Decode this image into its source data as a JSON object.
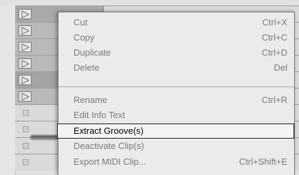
{
  "clips": [
    {
      "type": "filled",
      "shade": "top"
    },
    {
      "type": "filled",
      "shade": "light"
    },
    {
      "type": "filled",
      "shade": "light"
    },
    {
      "type": "filled",
      "shade": "light"
    },
    {
      "type": "filled",
      "shade": "dark"
    },
    {
      "type": "filled",
      "shade": "light"
    },
    {
      "type": "empty"
    },
    {
      "type": "empty"
    },
    {
      "type": "empty"
    },
    {
      "type": "empty"
    }
  ],
  "context_menu": {
    "items": [
      {
        "label": "Cut",
        "shortcut": "Ctrl+X",
        "state": "normal"
      },
      {
        "label": "Copy",
        "shortcut": "Ctrl+C",
        "state": "normal"
      },
      {
        "label": "Duplicate",
        "shortcut": "Ctrl+D",
        "state": "normal"
      },
      {
        "label": "Delete",
        "shortcut": "Del",
        "state": "normal"
      },
      {
        "label": "Rename",
        "shortcut": "Ctrl+R",
        "state": "normal"
      },
      {
        "label": "Edit Info Text",
        "shortcut": "",
        "state": "normal"
      },
      {
        "label": "Extract Groove(s)",
        "shortcut": "",
        "state": "selected"
      },
      {
        "label": "Deactivate Clip(s)",
        "shortcut": "",
        "state": "normal"
      },
      {
        "label": "Export MIDI Clip...",
        "shortcut": "Ctrl+Shift+E",
        "state": "normal"
      }
    ]
  },
  "colors": {
    "menu_background": "#ebebeb",
    "menu_text": "#7a7a7a",
    "selected_text": "#000000",
    "selected_border": "#1a1a1a"
  }
}
